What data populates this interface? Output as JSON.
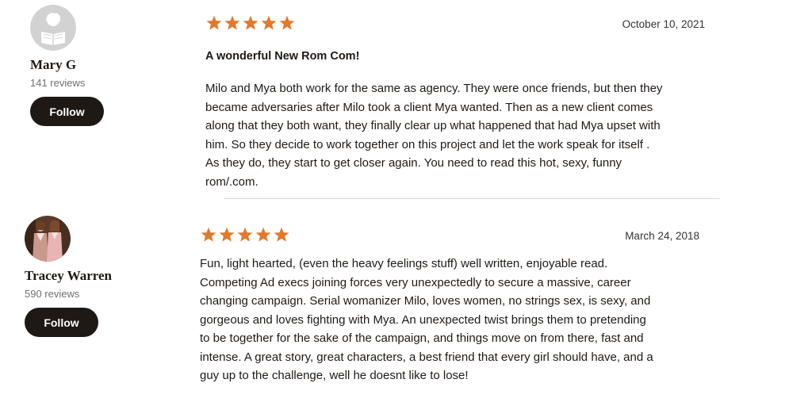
{
  "reviews": [
    {
      "user": {
        "name": "Mary G",
        "review_count": "141 reviews",
        "avatar": "default-reader-avatar",
        "follow_label": "Follow"
      },
      "rating": 5,
      "star_color": "#e07a2e",
      "date": "October 10, 2021",
      "title": "A wonderful New Rom Com!",
      "body_lines": [
        "Milo and Mya both work for the same as agency. They were once friends, but then they",
        "became adversaries after Milo took a client Mya wanted. Then as a new client comes",
        "along that they both want, they finally clear up what happened that had Mya upset with",
        "him. So they decide to work together on this project and let the work speak for itself .",
        "As they do, they start to get closer again. You need to read this hot, sexy, funny",
        "rom/.com."
      ]
    },
    {
      "user": {
        "name": "Tracey Warren",
        "review_count": "590 reviews",
        "avatar": "user-photo-avatar",
        "follow_label": "Follow"
      },
      "rating": 5,
      "star_color": "#e07a2e",
      "date": "March 24, 2018",
      "title": "",
      "body_lines": [
        "Fun, light hearted, (even the heavy feelings stuff) well written, enjoyable read.",
        "Competing Ad execs joining forces very unexpectedly to secure a massive, career",
        "changing campaign. Serial womanizer Milo, loves women, no strings sex, is sexy, and",
        "gorgeous and loves fighting with Mya. An unexpected twist brings them to pretending",
        "to be together for the sake of the campaign, and things move on from there, fast and",
        "intense. A great story, great characters, a best friend that every girl should have, and a",
        "guy up to the challenge, well he doesnt like to lose!"
      ]
    }
  ],
  "colors": {
    "text": "#1e1915",
    "muted": "#707070",
    "button_bg": "#1e1915",
    "button_text": "#ffffff",
    "divider": "#d8d8d8"
  }
}
